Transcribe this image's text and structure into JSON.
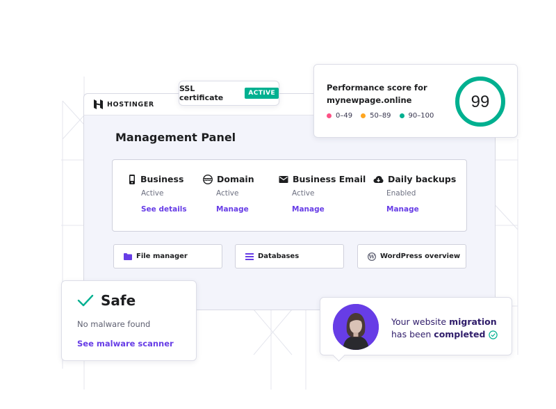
{
  "colors": {
    "accent": "#673de6",
    "success": "#00b090",
    "score_ring": "#00b090",
    "range_low": "#fc5185",
    "range_mid": "#ffa620",
    "range_high": "#00b090"
  },
  "window": {
    "logo_text": "HOSTINGER",
    "logo_icon": "hostinger-logo-icon",
    "title": "Management Panel"
  },
  "ssl": {
    "label": "SSL certificate",
    "badge": "ACTIVE"
  },
  "performance": {
    "title_line1": "Performance score for",
    "title_line2": "mynewpage.online",
    "score": 99,
    "score_text": "99",
    "legend": [
      {
        "label": "0–49",
        "color": "#fc5185"
      },
      {
        "label": "50–89",
        "color": "#ffa620"
      },
      {
        "label": "90–100",
        "color": "#00b090"
      }
    ]
  },
  "services": [
    {
      "icon": "phone-icon",
      "name": "Business",
      "status": "Active",
      "link": "See details"
    },
    {
      "icon": "www-globe-icon",
      "name": "Domain",
      "status": "Active",
      "link": "Manage"
    },
    {
      "icon": "envelope-icon",
      "name": "Business Email",
      "status": "Active",
      "link": "Manage"
    },
    {
      "icon": "cloud-download-icon",
      "name": "Daily backups",
      "status": "Enabled",
      "link": "Manage"
    }
  ],
  "tools": [
    {
      "icon": "folder-icon",
      "label": "File manager"
    },
    {
      "icon": "database-icon",
      "label": "Databases"
    },
    {
      "icon": "wordpress-icon",
      "label": "WordPress overview"
    }
  ],
  "safe": {
    "icon": "checkmark-icon",
    "title": "Safe",
    "subtitle": "No malware found",
    "link": "See malware scanner"
  },
  "migration": {
    "text_before": "Your website ",
    "text_bold1": "migration",
    "text_mid": "has been ",
    "text_bold2": "completed",
    "check_icon": "check-circle-icon"
  }
}
